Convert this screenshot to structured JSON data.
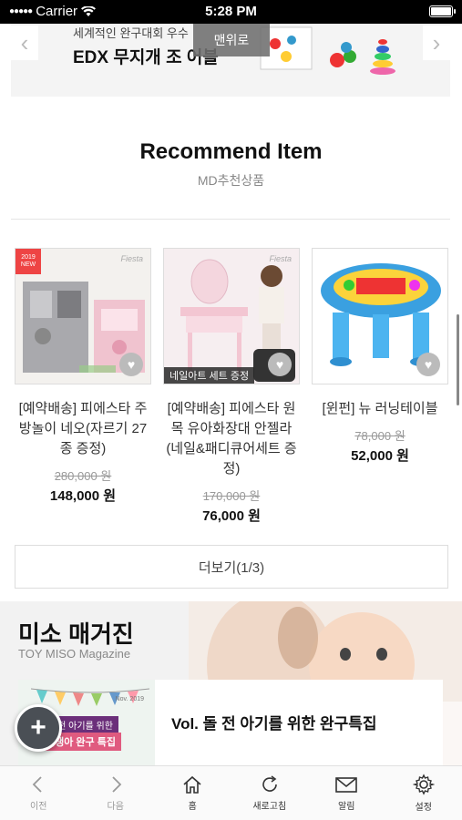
{
  "status_bar": {
    "carrier": "Carrier",
    "time": "5:28 PM"
  },
  "banner": {
    "subtitle": "세계적인 완구대회 우수",
    "title": "EDX 무지개 조 어블",
    "top_button": "맨위로"
  },
  "recommend": {
    "title": "Recommend Item",
    "subtitle": "MD추천상품",
    "products": [
      {
        "name": "[예약배송] 피에스타 주방놀이 네오(자르기 27종 증정)",
        "old_price": "280,000 원",
        "price": "148,000 원",
        "badge": "2019 NEW",
        "brand": "Fiesta"
      },
      {
        "name": "[예약배송] 피에스타 원목 유아화장대 안젤라(네일&패디큐어세트 증정)",
        "old_price": "170,000 원",
        "price": "76,000 원",
        "overlay": "네일아트 세트 증정",
        "brand": "Fiesta"
      },
      {
        "name": "[윈펀] 뉴 러닝테이블",
        "old_price": "78,000 원",
        "price": "52,000 원"
      }
    ],
    "more_button": "더보기(1/3)"
  },
  "magazine": {
    "title": "미소 매거진",
    "subtitle": "TOY MISO Magazine",
    "card_title": "Vol. 돌 전 아기를 위한 완구특집",
    "card_label_1": "돌 이전 아기를 위한",
    "card_label_2": "신생아 완구 특집",
    "card_date": "Nov. 2019"
  },
  "bottom_nav": [
    {
      "label": "이전",
      "icon": "chevron-left-icon"
    },
    {
      "label": "다음",
      "icon": "chevron-right-icon"
    },
    {
      "label": "홈",
      "icon": "home-icon"
    },
    {
      "label": "새로고침",
      "icon": "refresh-icon"
    },
    {
      "label": "알림",
      "icon": "mail-icon"
    },
    {
      "label": "설정",
      "icon": "gear-icon"
    }
  ],
  "colors": {
    "accent": "#e44444",
    "fab": "#4a4f55",
    "heart": "#bbbbbb"
  }
}
